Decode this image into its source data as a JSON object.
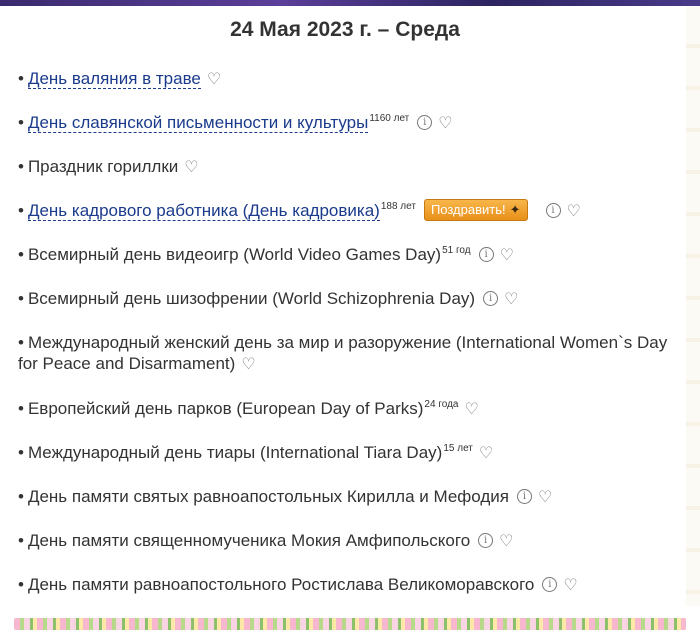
{
  "title": "24 Мая 2023 г. – Среда",
  "bullet": "•",
  "congrats_label": "Поздравить!",
  "icons": {
    "info": "info-icon",
    "heart": "heart-icon",
    "cracker": "party-popper-icon"
  },
  "colors": {
    "link": "#1a3a8c",
    "text": "#333333",
    "button": "#f0a02a"
  },
  "holidays": [
    {
      "name": "День валяния в траве",
      "link": true,
      "age": "",
      "info": false,
      "congrats": false
    },
    {
      "name": "День славянской письменности и культуры",
      "link": true,
      "age": "1160 лет",
      "info": true,
      "congrats": false
    },
    {
      "name": "Праздник гориллки",
      "link": false,
      "age": "",
      "info": false,
      "congrats": false
    },
    {
      "name": "День кадрового работника (День кадровика)",
      "link": true,
      "age": "188 лет",
      "info": true,
      "congrats": true
    },
    {
      "name": "Всемирный день видеоигр (World Video Games Day)",
      "link": false,
      "age": "51 год",
      "info": true,
      "congrats": false
    },
    {
      "name": "Всемирный день шизофрении (World Schizophrenia Day)",
      "link": false,
      "age": "",
      "info": true,
      "congrats": false
    },
    {
      "name": "Международный женский день за мир и разоружение (International Women`s Day for Peace and Disarmament)",
      "link": false,
      "age": "",
      "info": false,
      "congrats": false
    },
    {
      "name": "Европейский день парков (European Day of Parks)",
      "link": false,
      "age": "24 года",
      "info": false,
      "congrats": false
    },
    {
      "name": "Международный день тиары (International Tiara Day)",
      "link": false,
      "age": "15 лет",
      "info": false,
      "congrats": false
    },
    {
      "name": "День памяти святых равноапостольных Кирилла и Мефодия",
      "link": false,
      "age": "",
      "info": true,
      "congrats": false
    },
    {
      "name": "День памяти священномученика Мокия Амфипольского",
      "link": false,
      "age": "",
      "info": true,
      "congrats": false
    },
    {
      "name": "День памяти равноапостольного Ростислава Великоморавского",
      "link": false,
      "age": "",
      "info": true,
      "congrats": false
    }
  ]
}
